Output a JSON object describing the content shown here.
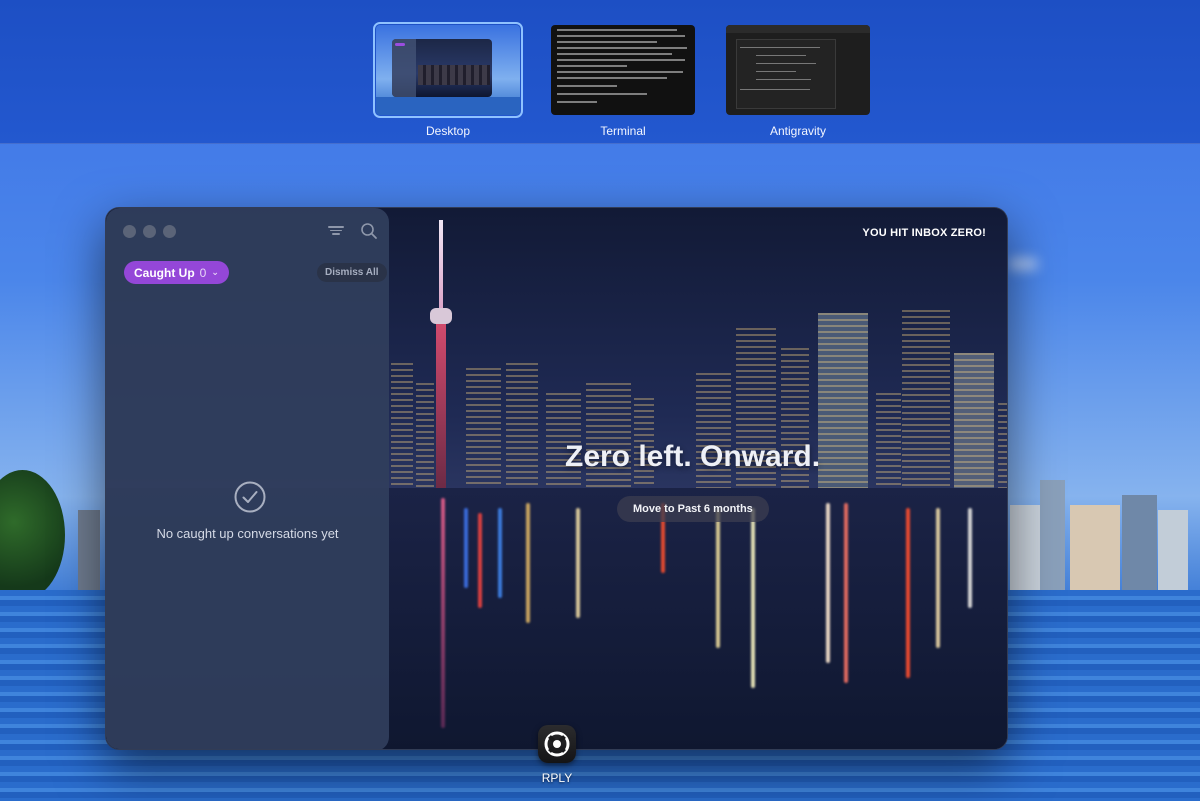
{
  "spaces": [
    {
      "label": "Desktop",
      "selected": true
    },
    {
      "label": "Terminal",
      "selected": false
    },
    {
      "label": "Antigravity",
      "selected": false
    }
  ],
  "app": {
    "sidebar": {
      "filter_button": "Caught Up",
      "filter_count": "0",
      "dismiss_label": "Dismiss All",
      "empty_message": "No caught up conversations yet",
      "icons": [
        "filter-icon",
        "search-icon",
        "check-circle-icon",
        "chevron-down-icon"
      ]
    },
    "banner": "YOU HIT INBOX ZERO!",
    "headline": "Zero left. Onward.",
    "move_button": "Move to Past 6 months"
  },
  "dock": {
    "app_label": "RPLY",
    "icon": "rply-app-icon"
  },
  "colors": {
    "accent_purple": "#9447d8",
    "wallpaper_blue": "#2f64d8",
    "sidebar": "#303e5c"
  }
}
